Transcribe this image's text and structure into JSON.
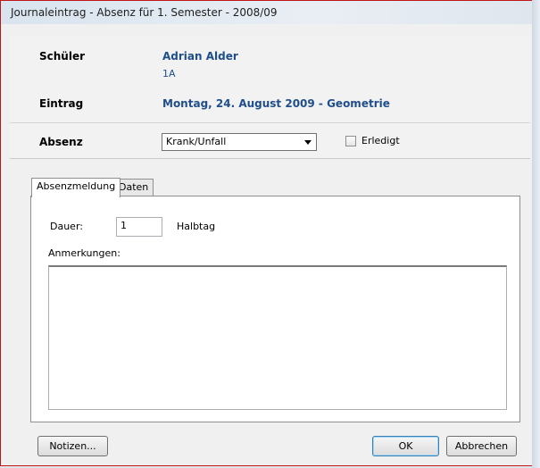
{
  "window": {
    "title": "Journaleintrag - Absenz für 1. Semester - 2008/09"
  },
  "header": {
    "student_label": "Schüler",
    "student_name": "Adrian Alder",
    "student_class": "1A",
    "entry_label": "Eintrag",
    "entry_value": "Montag, 24. August 2009 - Geometrie",
    "absence_label": "Absenz",
    "absence_type": {
      "selected": "Krank/Unfall"
    },
    "done_checkbox": {
      "label": "Erledigt",
      "checked": false
    }
  },
  "tabs": [
    {
      "label": "Absenzmeldung",
      "active": true
    },
    {
      "label": "Daten",
      "active": false
    }
  ],
  "form": {
    "duration_label": "Dauer:",
    "duration_value": "1",
    "duration_unit": "Halbtag",
    "notes_label": "Anmerkungen:",
    "notes_value": ""
  },
  "buttons": {
    "notes": "Notizen...",
    "ok": "OK",
    "cancel": "Abbrechen"
  }
}
